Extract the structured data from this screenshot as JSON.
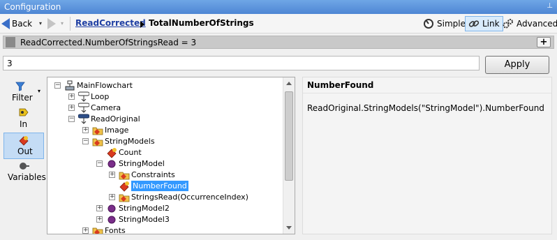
{
  "window": {
    "title": "Configuration",
    "pin_glyph": "⊥"
  },
  "nav": {
    "back_label": "Back",
    "dropdown_glyph": "▾",
    "breadcrumb": [
      "ReadCorrected",
      "TotalNumberOfStrings"
    ],
    "modes": [
      {
        "label": "Simple",
        "icon": "dial-icon",
        "active": false
      },
      {
        "label": "Link",
        "icon": "link-icon",
        "active": true
      },
      {
        "label": "Advanced",
        "icon": "gears-icon",
        "active": false
      }
    ]
  },
  "expression": {
    "text": "ReadCorrected.NumberOfStringsRead = 3",
    "add_glyph": "+"
  },
  "value": {
    "text": "3"
  },
  "apply_label": "Apply",
  "left_tools": [
    {
      "label": "Filter",
      "icon": "funnel-icon",
      "active": false
    },
    {
      "label": "In",
      "icon": "input-icon",
      "active": false
    },
    {
      "label": "Out",
      "icon": "output-icon",
      "active": true
    },
    {
      "label": "Variables",
      "icon": "variable-icon",
      "active": false
    }
  ],
  "tree": {
    "items": [
      {
        "label": "MainFlowchart",
        "icon": "flowchart-icon",
        "expander": "−"
      },
      {
        "label": "Loop",
        "icon": "loop-step-icon",
        "expander": "+"
      },
      {
        "label": "Camera",
        "icon": "camera-step-icon",
        "expander": "+"
      },
      {
        "label": "ReadOriginal",
        "icon": "read-step-icon",
        "expander": "−"
      },
      {
        "label": "Image",
        "icon": "output-folder-icon",
        "expander": "+"
      },
      {
        "label": "StringModels",
        "icon": "output-folder-icon",
        "expander": "−"
      },
      {
        "label": "Count",
        "icon": "output-value-icon",
        "expander": ""
      },
      {
        "label": "StringModel",
        "icon": "object-icon",
        "expander": "−"
      },
      {
        "label": "Constraints",
        "icon": "output-folder-icon",
        "expander": "+"
      },
      {
        "label": "NumberFound",
        "icon": "output-value-icon",
        "expander": "",
        "selected": true
      },
      {
        "label": "StringsRead(OccurrenceIndex)",
        "icon": "output-folder-icon",
        "expander": "+"
      },
      {
        "label": "StringModel2",
        "icon": "object-icon",
        "expander": "+"
      },
      {
        "label": "StringModel3",
        "icon": "object-icon",
        "expander": "+"
      },
      {
        "label": "Fonts",
        "icon": "output-folder-icon",
        "expander": "+"
      }
    ]
  },
  "detail": {
    "title": "NumberFound",
    "path": "ReadOriginal.StringModels(\"StringModel\").NumberFound"
  },
  "colors": {
    "accent": "#3399ff",
    "titlebar": "#5b93dc",
    "link": "#1f3fa3"
  }
}
